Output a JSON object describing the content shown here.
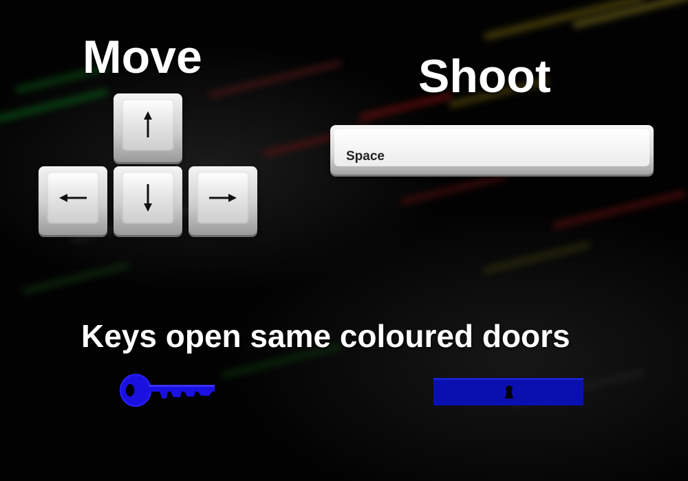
{
  "headings": {
    "move": "Move",
    "shoot": "Shoot",
    "door_hint": "Keys open same coloured doors"
  },
  "controls": {
    "move_keys": [
      {
        "direction": "up",
        "icon": "arrow-up-icon"
      },
      {
        "direction": "left",
        "icon": "arrow-left-icon"
      },
      {
        "direction": "down",
        "icon": "arrow-down-icon"
      },
      {
        "direction": "right",
        "icon": "arrow-right-icon"
      }
    ],
    "shoot_key_label": "Space"
  },
  "items": {
    "key_icon": "blue-key-icon",
    "door_icon": "blue-locked-door-icon",
    "key_color": "#1a10e0",
    "door_color": "#0a10b0"
  },
  "colors": {
    "background": "#050505",
    "heading_text": "#ffffff",
    "keycap": "#e4e4e4"
  }
}
